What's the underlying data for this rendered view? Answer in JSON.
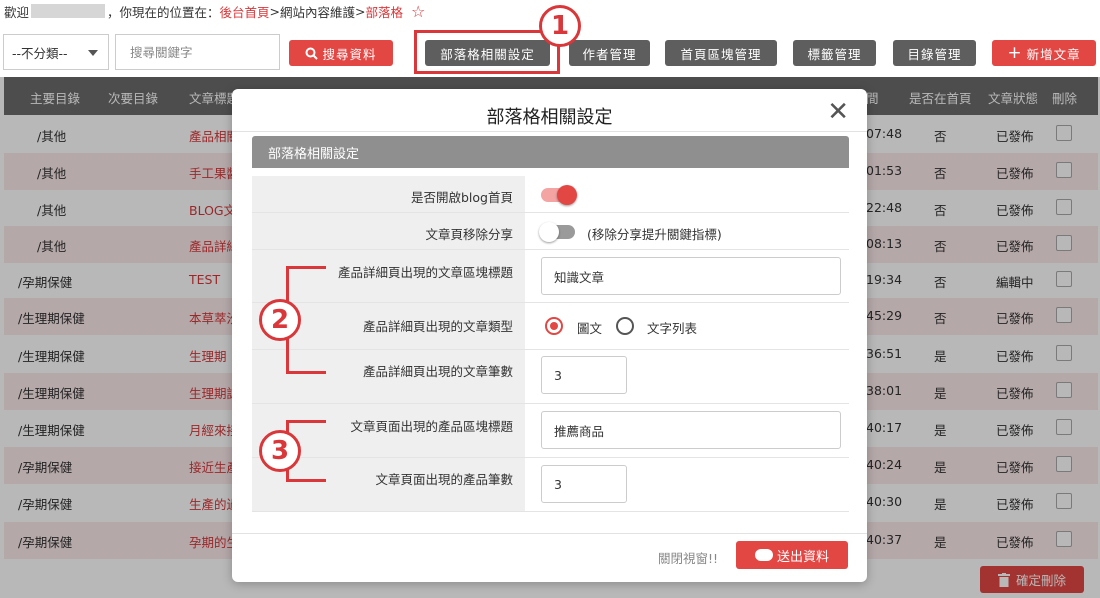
{
  "topbar": {
    "welcome": "歡迎",
    "location_prefix": "，你現在的位置在：",
    "crumb_home": "後台首頁",
    "crumb_sep1": ">",
    "crumb_maintain": "網站內容維護",
    "crumb_sep2": ">",
    "crumb_current": "部落格"
  },
  "toolbar": {
    "category_select": "--不分類--",
    "search_placeholder": "搜尋關鍵字",
    "search_button": "搜尋資料",
    "blog_settings_button": "部落格相關設定",
    "author_button": "作者管理",
    "home_blocks_button": "首頁區塊管理",
    "tags_button": "標籤管理",
    "catalog_button": "目錄管理",
    "new_post_button": "新增文章"
  },
  "table": {
    "headers": {
      "main_cat": "主要目錄",
      "sub_cat": "次要目錄",
      "title": "文章標題",
      "time_partial": "間",
      "is_home": "是否在首頁",
      "status": "文章狀態",
      "delete": "刪除"
    },
    "rows": [
      {
        "main": "/其他",
        "title": "產品相關",
        "time": "07:48",
        "home": "否",
        "status": "已發佈"
      },
      {
        "main": "/其他",
        "title": "手工果醬",
        "time": "01:53",
        "home": "否",
        "status": "已發佈"
      },
      {
        "main": "/其他",
        "title": "BLOG文",
        "time": "22:48",
        "home": "否",
        "status": "已發佈"
      },
      {
        "main": "/其他",
        "title": "產品詳細",
        "time": "08:13",
        "home": "否",
        "status": "已發佈"
      },
      {
        "main": "/孕期保健",
        "title": "TEST",
        "time": "19:34",
        "home": "否",
        "status": "編輯中"
      },
      {
        "main": "/生理期保健",
        "title": "本草萃汐",
        "time": "45:29",
        "home": "否",
        "status": "已發佈"
      },
      {
        "main": "/生理期保健",
        "title": "生理期",
        "time": "36:51",
        "home": "是",
        "status": "已發佈"
      },
      {
        "main": "/生理期保健",
        "title": "生理期認",
        "time": "38:01",
        "home": "是",
        "status": "已發佈"
      },
      {
        "main": "/生理期保健",
        "title": "月經來接",
        "time": "40:17",
        "home": "是",
        "status": "已發佈"
      },
      {
        "main": "/孕期保健",
        "title": "接近生產",
        "time": "40:24",
        "home": "是",
        "status": "已發佈"
      },
      {
        "main": "/孕期保健",
        "title": "生產的過",
        "time": "40:30",
        "home": "是",
        "status": "已發佈"
      },
      {
        "main": "/孕期保健",
        "title": "孕期的生",
        "time": "40:37",
        "home": "是",
        "status": "已發佈"
      }
    ],
    "confirm_delete": "確定刪除"
  },
  "modal": {
    "title": "部落格相關設定",
    "panel_title": "部落格相關設定",
    "fields": {
      "blog_home_label": "是否開啟blog首頁",
      "blog_home_on": true,
      "remove_share_label": "文章頁移除分享",
      "remove_share_on": false,
      "remove_share_note": "(移除分享提升關鍵指標)",
      "detail_block_title_label": "產品詳細頁出現的文章區塊標題",
      "detail_block_title_value": "知識文章",
      "detail_type_label": "產品詳細頁出現的文章類型",
      "type_option_image": "圖文",
      "type_option_text": "文字列表",
      "detail_count_label": "產品詳細頁出現的文章筆數",
      "detail_count_value": "3",
      "article_block_title_label": "文章頁面出現的產品區塊標題",
      "article_block_title_value": "推薦商品",
      "article_count_label": "文章頁面出現的產品筆數",
      "article_count_value": "3"
    },
    "close_link": "關閉視窗!!",
    "submit_button": "送出資料"
  },
  "annotations": {
    "badge1": "1",
    "badge2": "2",
    "badge3": "3"
  },
  "colors": {
    "accent": "#e24744",
    "dark_button": "#5e5e5e",
    "header": "#6b6b6b",
    "row_alt": "#fbe9ea"
  }
}
